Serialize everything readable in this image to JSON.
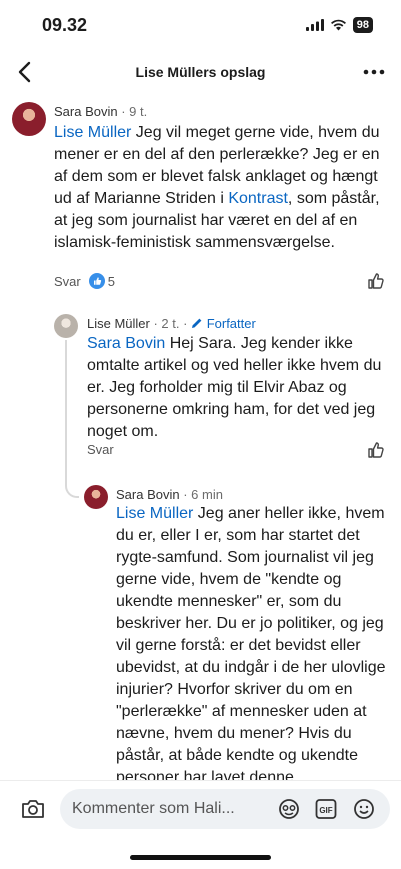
{
  "status_bar": {
    "time": "09.32",
    "battery": "98"
  },
  "nav": {
    "title": "Lise Müllers opslag"
  },
  "comment": {
    "author": "Sara Bovin",
    "meta": "· 9 t.",
    "mention": "Lise Müller",
    "text_1": " Jeg vil meget gerne vide, hvem du mener er en del af den perlerække? Jeg er en af dem som er blevet falsk anklaget og hængt ud af Marianne Striden i ",
    "link_2": "Kontrast",
    "text_2": ", som påstår, at jeg som journalist har været en del af en islamisk-feministisk sammensværgelse.",
    "reply_label": "Svar",
    "like_count": "5"
  },
  "reply_1": {
    "author": "Lise Müller",
    "meta": "· 2 t. ·",
    "badge": "Forfatter",
    "mention": "Sara Bovin",
    "text": " Hej Sara. Jeg kender ikke omtalte artikel og ved heller ikke hvem du er. Jeg forholder mig til Elvir Abaz og personerne omkring ham, for det ved jeg noget om.",
    "reply_label": "Svar"
  },
  "reply_2": {
    "author": "Sara Bovin",
    "meta": "· 6 min",
    "mention": "Lise Müller",
    "text": " Jeg aner heller ikke, hvem du er, eller I er, som har startet det rygte-samfund. Som journalist vil jeg gerne vide, hvem de \"kendte og ukendte mennesker\" er, som du beskriver her. Du er jo politiker, og jeg vil gerne forstå: er det bevidst eller ubevidst, at du indgår i de her ulovlige injurier? Hvorfor skriver du om en \"perlerække\" af mennesker uden at nævne, hvem du mener? Hvis du påstår, at både kendte og ukendte personer har lavet denne"
  },
  "compose": {
    "placeholder": "Kommenter som Hali..."
  },
  "colors": {
    "link": "#0a66c2",
    "text": "#1c1c1c",
    "muted": "#6b6b6b"
  },
  "icons": [
    "back-icon",
    "more-icon",
    "like-icon",
    "pencil-icon",
    "camera-icon",
    "sticker-icon",
    "gif-icon",
    "emoji-icon",
    "signal-icon",
    "wifi-icon",
    "battery-icon"
  ]
}
